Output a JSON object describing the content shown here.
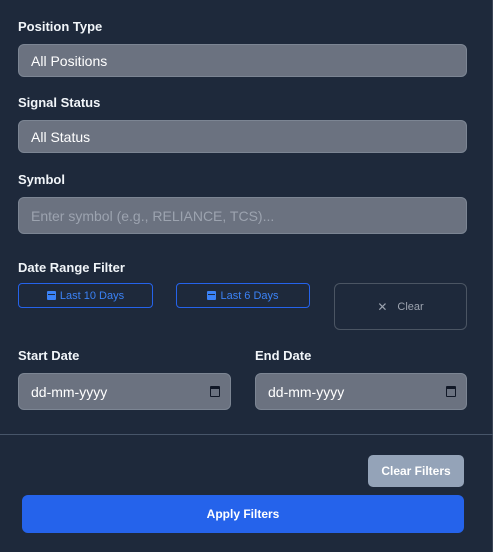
{
  "position_type": {
    "label": "Position Type",
    "value": "All Positions"
  },
  "signal_status": {
    "label": "Signal Status",
    "value": "All Status"
  },
  "symbol": {
    "label": "Symbol",
    "placeholder": "Enter symbol (e.g., RELIANCE, TCS)..."
  },
  "date_range": {
    "label": "Date Range Filter",
    "last10_label": "Last 10 Days",
    "last6_label": "Last 6 Days",
    "clear_label": "Clear"
  },
  "start_date": {
    "label": "Start Date",
    "value": "dd-mm-yyyy"
  },
  "end_date": {
    "label": "End Date",
    "value": "dd-mm-yyyy"
  },
  "actions": {
    "clear_filters": "Clear Filters",
    "apply_filters": "Apply Filters"
  },
  "colors": {
    "background": "#1e293b",
    "accent": "#2563eb",
    "field": "#6b7280"
  }
}
